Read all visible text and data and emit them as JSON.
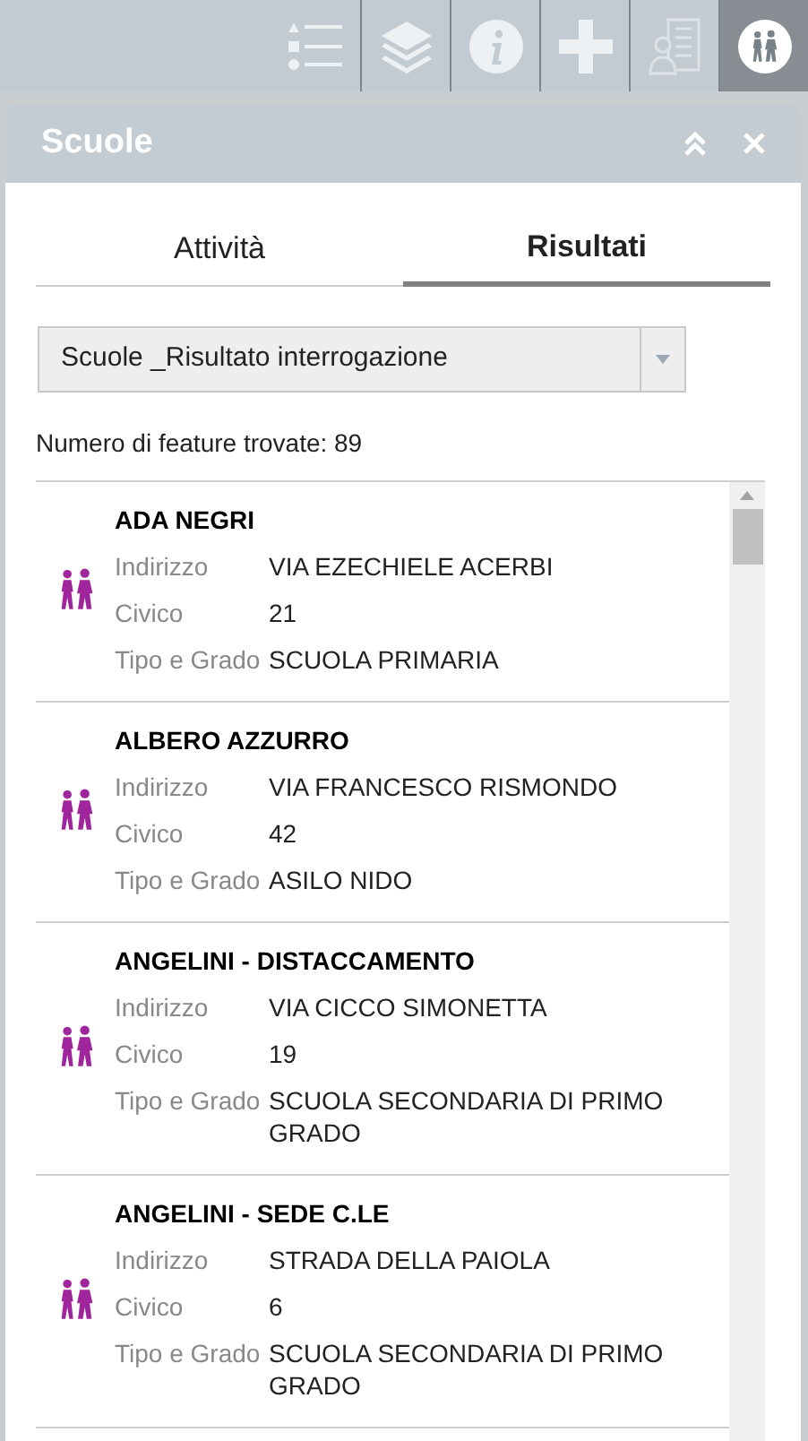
{
  "toolbar": [
    {
      "kind": "legend",
      "selected": false
    },
    {
      "kind": "layers",
      "selected": false
    },
    {
      "kind": "info",
      "selected": false
    },
    {
      "kind": "plus",
      "selected": false
    },
    {
      "kind": "office",
      "selected": false
    },
    {
      "kind": "school",
      "selected": true
    }
  ],
  "panel": {
    "title": "Scuole"
  },
  "tabs": [
    {
      "label": "Attività",
      "selected": false
    },
    {
      "label": "Risultati",
      "selected": true
    }
  ],
  "dropdown": {
    "value": "Scuole _Risultato interrogazione"
  },
  "count": "Numero di feature trovate: 89",
  "results": [
    {
      "name": "ADA NEGRI",
      "fields": [
        {
          "label": "Indirizzo",
          "value": "VIA EZECHIELE ACERBI"
        },
        {
          "label": "Civico",
          "value": "21"
        },
        {
          "label": "Tipo e Grado",
          "value": "SCUOLA PRIMARIA"
        }
      ]
    },
    {
      "name": "ALBERO AZZURRO",
      "fields": [
        {
          "label": "Indirizzo",
          "value": "VIA FRANCESCO RISMONDO"
        },
        {
          "label": "Civico",
          "value": "42"
        },
        {
          "label": "Tipo e Grado",
          "value": "ASILO NIDO"
        }
      ]
    },
    {
      "name": "ANGELINI - DISTACCAMENTO",
      "fields": [
        {
          "label": "Indirizzo",
          "value": "VIA CICCO SIMONETTA"
        },
        {
          "label": "Civico",
          "value": "19"
        },
        {
          "label": "Tipo e Grado",
          "value": "SCUOLA SECONDARIA DI PRIMO GRADO"
        }
      ]
    },
    {
      "name": "ANGELINI - SEDE C.LE",
      "fields": [
        {
          "label": "Indirizzo",
          "value": "STRADA DELLA PAIOLA"
        },
        {
          "label": "Civico",
          "value": "6"
        },
        {
          "label": "Tipo e Grado",
          "value": "SCUOLA SECONDARIA DI PRIMO GRADO"
        }
      ]
    }
  ]
}
